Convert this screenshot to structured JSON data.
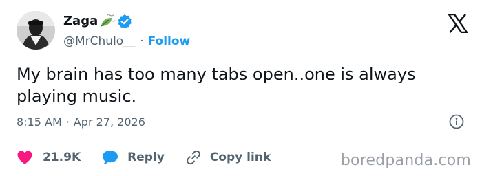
{
  "author": {
    "display_name": "Zaga",
    "handle": "@MrChulo__",
    "follow_label": "Follow",
    "separator": "·",
    "emoji_icon": "leaf-fluttering-in-wind-icon",
    "verified_icon": "verified-badge-icon"
  },
  "tweet": {
    "text": "My brain has too many tabs open..one is always playing music.",
    "time": "8:15 AM",
    "date_separator": "·",
    "date": "Apr 27, 2026"
  },
  "actions": {
    "like_count": "21.9K",
    "reply_label": "Reply",
    "copy_link_label": "Copy link"
  },
  "watermark": "boredpanda.com",
  "colors": {
    "accent": "#1d9bf0",
    "like": "#f91880",
    "text_primary": "#0f1419",
    "text_secondary": "#536471",
    "divider": "#cfd9de",
    "watermark": "#9aa0a6"
  }
}
